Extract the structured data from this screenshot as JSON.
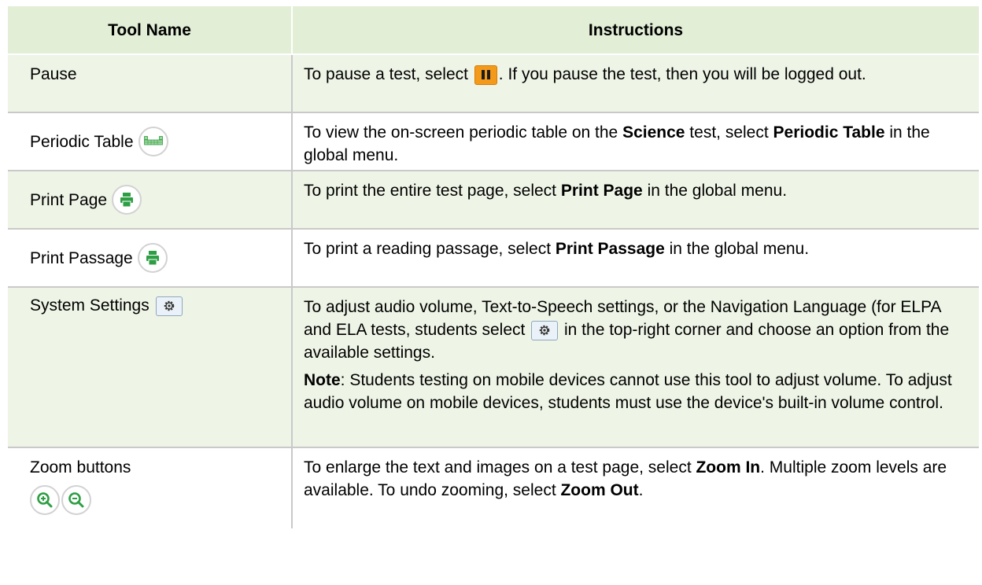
{
  "headers": {
    "tool_name": "Tool Name",
    "instructions": "Instructions"
  },
  "rows": [
    {
      "name": "Pause",
      "inst": {
        "a": "To pause a test, select ",
        "b": ". If you pause the test, then you will be logged out."
      }
    },
    {
      "name": "Periodic Table",
      "inst": {
        "a": "To view the on-screen periodic table on the ",
        "b1": "Science",
        "c": " test, select ",
        "b2": "Periodic Table",
        "d": " in the global menu."
      }
    },
    {
      "name": "Print Page",
      "inst": {
        "a": "To print the entire test page, select ",
        "b": "Print Page",
        "c": " in the global menu."
      }
    },
    {
      "name": "Print Passage",
      "inst": {
        "a": "To print a reading passage, select ",
        "b": "Print Passage",
        "c": " in the global menu."
      }
    },
    {
      "name": "System Settings",
      "inst": {
        "a": "To adjust audio volume, Text-to-Speech settings, or the Navigation Language (for ELPA and ELA tests, students select ",
        "b": " in the top-right corner and choose an option from the available settings.",
        "note_label": "Note",
        "note_text": ": Students testing on mobile devices cannot use this tool to adjust volume. To adjust audio volume on mobile devices, students must use the device's built-in volume control."
      }
    },
    {
      "name": "Zoom buttons",
      "inst": {
        "a": "To enlarge the text and images on a test page, select ",
        "b1": "Zoom In",
        "c": ". Multiple zoom levels are available. To undo zooming, select ",
        "b2": "Zoom Out",
        "d": "."
      }
    }
  ],
  "icons": {
    "pause": "pause-icon",
    "periodic_table": "periodic-table-icon",
    "print": "printer-icon",
    "settings": "gear-icon",
    "zoom_in": "zoom-in-icon",
    "zoom_out": "zoom-out-icon"
  },
  "colors": {
    "header_bg": "#e2eed6",
    "shaded_row": "#eef4e6",
    "icon_green": "#2e9e44",
    "pause_orange": "#f39a1b"
  }
}
